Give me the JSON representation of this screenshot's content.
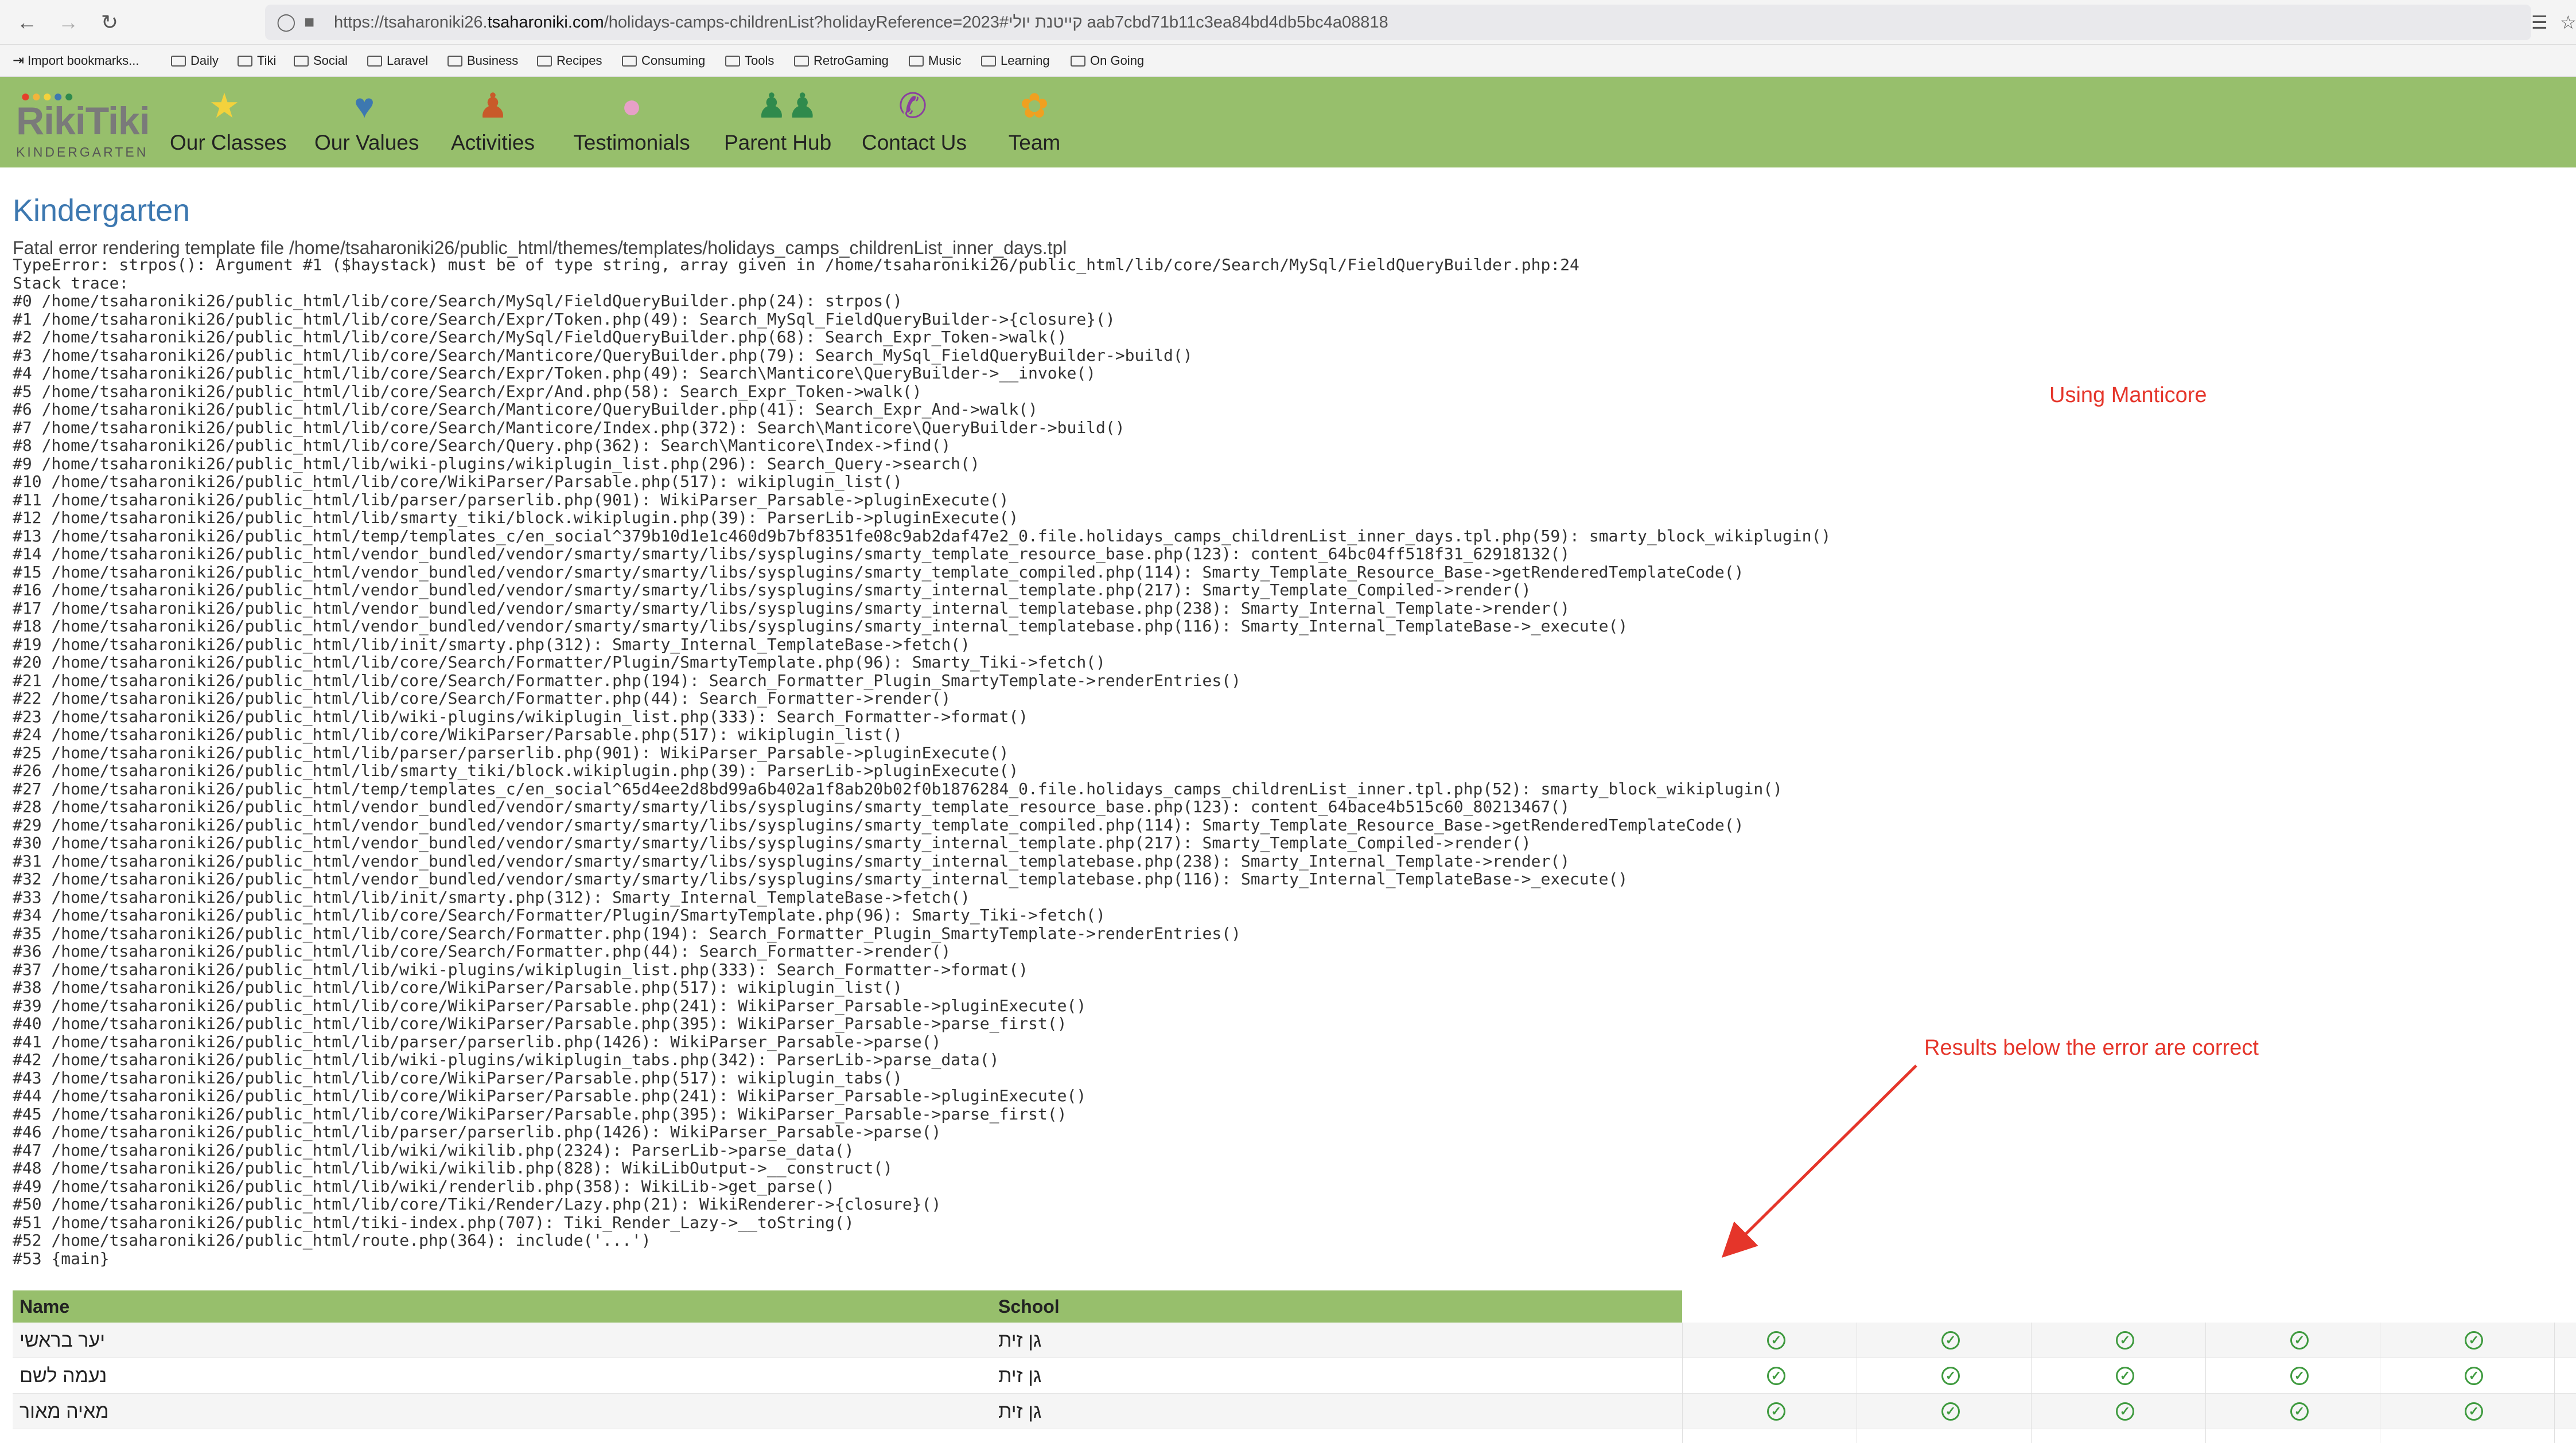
{
  "browser": {
    "url_prefix": "https://tsaharoniki26.",
    "url_domain": "tsaharoniki.com",
    "url_path": "/holidays-camps-childrenList?holidayReference=2023#קייטנת יולי aab7cbd71b11c3ea84bd4db5bc4a08818",
    "bookmarks": [
      "Import bookmarks...",
      "Daily",
      "Tiki",
      "Social",
      "Laravel",
      "Business",
      "Recipes",
      "Consuming",
      "Tools",
      "RetroGaming",
      "Music",
      "Learning",
      "On Going"
    ]
  },
  "site": {
    "logo_text": "RikiTiki",
    "logo_sub": "KINDERGARTEN",
    "nav": [
      {
        "label": "Our Classes",
        "icon": "star-icon",
        "glyph": "★",
        "color": "#f3d23c"
      },
      {
        "label": "Our Values",
        "icon": "hand-heart-icon",
        "glyph": "♥",
        "color": "#3d78b0"
      },
      {
        "label": "Activities",
        "icon": "person-icon",
        "glyph": "♟",
        "color": "#c85a2a"
      },
      {
        "label": "Testimonials",
        "icon": "speech-bubble-icon",
        "glyph": "●",
        "color": "#e7a0c8"
      },
      {
        "label": "Parent Hub",
        "icon": "people-icon",
        "glyph": "♟♟",
        "color": "#2f8a4c"
      },
      {
        "label": "Contact Us",
        "icon": "phone-icon",
        "glyph": "✆",
        "color": "#8a3ea0"
      },
      {
        "label": "Team",
        "icon": "team-icon",
        "glyph": "✿",
        "color": "#f0a020"
      }
    ]
  },
  "page": {
    "title": "Kindergarten",
    "error_file": "Fatal error rendering template file /home/tsaharoniki26/public_html/themes/templates/holidays_camps_childrenList_inner_days.tpl",
    "trace": [
      "TypeError: strpos(): Argument #1 ($haystack) must be of type string, array given in /home/tsaharoniki26/public_html/lib/core/Search/MySql/FieldQueryBuilder.php:24",
      "Stack trace:",
      "#0 /home/tsaharoniki26/public_html/lib/core/Search/MySql/FieldQueryBuilder.php(24): strpos()",
      "#1 /home/tsaharoniki26/public_html/lib/core/Search/Expr/Token.php(49): Search_MySql_FieldQueryBuilder->{closure}()",
      "#2 /home/tsaharoniki26/public_html/lib/core/Search/MySql/FieldQueryBuilder.php(68): Search_Expr_Token->walk()",
      "#3 /home/tsaharoniki26/public_html/lib/core/Search/Manticore/QueryBuilder.php(79): Search_MySql_FieldQueryBuilder->build()",
      "#4 /home/tsaharoniki26/public_html/lib/core/Search/Expr/Token.php(49): Search\\Manticore\\QueryBuilder->__invoke()",
      "#5 /home/tsaharoniki26/public_html/lib/core/Search/Expr/And.php(58): Search_Expr_Token->walk()",
      "#6 /home/tsaharoniki26/public_html/lib/core/Search/Manticore/QueryBuilder.php(41): Search_Expr_And->walk()",
      "#7 /home/tsaharoniki26/public_html/lib/core/Search/Manticore/Index.php(372): Search\\Manticore\\QueryBuilder->build()",
      "#8 /home/tsaharoniki26/public_html/lib/core/Search/Query.php(362): Search\\Manticore\\Index->find()",
      "#9 /home/tsaharoniki26/public_html/lib/wiki-plugins/wikiplugin_list.php(296): Search_Query->search()",
      "#10 /home/tsaharoniki26/public_html/lib/core/WikiParser/Parsable.php(517): wikiplugin_list()",
      "#11 /home/tsaharoniki26/public_html/lib/parser/parserlib.php(901): WikiParser_Parsable->pluginExecute()",
      "#12 /home/tsaharoniki26/public_html/lib/smarty_tiki/block.wikiplugin.php(39): ParserLib->pluginExecute()",
      "#13 /home/tsaharoniki26/public_html/temp/templates_c/en_social^379b10d1e1c460d9b7bf8351fe08c9ab2daf47e2_0.file.holidays_camps_childrenList_inner_days.tpl.php(59): smarty_block_wikiplugin()",
      "#14 /home/tsaharoniki26/public_html/vendor_bundled/vendor/smarty/smarty/libs/sysplugins/smarty_template_resource_base.php(123): content_64bc04ff518f31_62918132()",
      "#15 /home/tsaharoniki26/public_html/vendor_bundled/vendor/smarty/smarty/libs/sysplugins/smarty_template_compiled.php(114): Smarty_Template_Resource_Base->getRenderedTemplateCode()",
      "#16 /home/tsaharoniki26/public_html/vendor_bundled/vendor/smarty/smarty/libs/sysplugins/smarty_internal_template.php(217): Smarty_Template_Compiled->render()",
      "#17 /home/tsaharoniki26/public_html/vendor_bundled/vendor/smarty/smarty/libs/sysplugins/smarty_internal_templatebase.php(238): Smarty_Internal_Template->render()",
      "#18 /home/tsaharoniki26/public_html/vendor_bundled/vendor/smarty/smarty/libs/sysplugins/smarty_internal_templatebase.php(116): Smarty_Internal_TemplateBase->_execute()",
      "#19 /home/tsaharoniki26/public_html/lib/init/smarty.php(312): Smarty_Internal_TemplateBase->fetch()",
      "#20 /home/tsaharoniki26/public_html/lib/core/Search/Formatter/Plugin/SmartyTemplate.php(96): Smarty_Tiki->fetch()",
      "#21 /home/tsaharoniki26/public_html/lib/core/Search/Formatter.php(194): Search_Formatter_Plugin_SmartyTemplate->renderEntries()",
      "#22 /home/tsaharoniki26/public_html/lib/core/Search/Formatter.php(44): Search_Formatter->render()",
      "#23 /home/tsaharoniki26/public_html/lib/wiki-plugins/wikiplugin_list.php(333): Search_Formatter->format()",
      "#24 /home/tsaharoniki26/public_html/lib/core/WikiParser/Parsable.php(517): wikiplugin_list()",
      "#25 /home/tsaharoniki26/public_html/lib/parser/parserlib.php(901): WikiParser_Parsable->pluginExecute()",
      "#26 /home/tsaharoniki26/public_html/lib/smarty_tiki/block.wikiplugin.php(39): ParserLib->pluginExecute()",
      "#27 /home/tsaharoniki26/public_html/temp/templates_c/en_social^65d4ee2d8bd99a6b402a1f8ab20b02f0b1876284_0.file.holidays_camps_childrenList_inner.tpl.php(52): smarty_block_wikiplugin()",
      "#28 /home/tsaharoniki26/public_html/vendor_bundled/vendor/smarty/smarty/libs/sysplugins/smarty_template_resource_base.php(123): content_64bace4b515c60_80213467()",
      "#29 /home/tsaharoniki26/public_html/vendor_bundled/vendor/smarty/smarty/libs/sysplugins/smarty_template_compiled.php(114): Smarty_Template_Resource_Base->getRenderedTemplateCode()",
      "#30 /home/tsaharoniki26/public_html/vendor_bundled/vendor/smarty/smarty/libs/sysplugins/smarty_internal_template.php(217): Smarty_Template_Compiled->render()",
      "#31 /home/tsaharoniki26/public_html/vendor_bundled/vendor/smarty/smarty/libs/sysplugins/smarty_internal_templatebase.php(238): Smarty_Internal_Template->render()",
      "#32 /home/tsaharoniki26/public_html/vendor_bundled/vendor/smarty/smarty/libs/sysplugins/smarty_internal_templatebase.php(116): Smarty_Internal_TemplateBase->_execute()",
      "#33 /home/tsaharoniki26/public_html/lib/init/smarty.php(312): Smarty_Internal_TemplateBase->fetch()",
      "#34 /home/tsaharoniki26/public_html/lib/core/Search/Formatter/Plugin/SmartyTemplate.php(96): Smarty_Tiki->fetch()",
      "#35 /home/tsaharoniki26/public_html/lib/core/Search/Formatter.php(194): Search_Formatter_Plugin_SmartyTemplate->renderEntries()",
      "#36 /home/tsaharoniki26/public_html/lib/core/Search/Formatter.php(44): Search_Formatter->render()",
      "#37 /home/tsaharoniki26/public_html/lib/wiki-plugins/wikiplugin_list.php(333): Search_Formatter->format()",
      "#38 /home/tsaharoniki26/public_html/lib/core/WikiParser/Parsable.php(517): wikiplugin_list()",
      "#39 /home/tsaharoniki26/public_html/lib/core/WikiParser/Parsable.php(241): WikiParser_Parsable->pluginExecute()",
      "#40 /home/tsaharoniki26/public_html/lib/core/WikiParser/Parsable.php(395): WikiParser_Parsable->parse_first()",
      "#41 /home/tsaharoniki26/public_html/lib/parser/parserlib.php(1426): WikiParser_Parsable->parse()",
      "#42 /home/tsaharoniki26/public_html/lib/wiki-plugins/wikiplugin_tabs.php(342): ParserLib->parse_data()",
      "#43 /home/tsaharoniki26/public_html/lib/core/WikiParser/Parsable.php(517): wikiplugin_tabs()",
      "#44 /home/tsaharoniki26/public_html/lib/core/WikiParser/Parsable.php(241): WikiParser_Parsable->pluginExecute()",
      "#45 /home/tsaharoniki26/public_html/lib/core/WikiParser/Parsable.php(395): WikiParser_Parsable->parse_first()",
      "#46 /home/tsaharoniki26/public_html/lib/parser/parserlib.php(1426): WikiParser_Parsable->parse()",
      "#47 /home/tsaharoniki26/public_html/lib/wiki/wikilib.php(2324): ParserLib->parse_data()",
      "#48 /home/tsaharoniki26/public_html/lib/wiki/wikilib.php(828): WikiLibOutput->__construct()",
      "#49 /home/tsaharoniki26/public_html/lib/wiki/renderlib.php(358): WikiLib->get_parse()",
      "#50 /home/tsaharoniki26/public_html/lib/core/Tiki/Render/Lazy.php(21): WikiRenderer->{closure}()",
      "#51 /home/tsaharoniki26/public_html/tiki-index.php(707): Tiki_Render_Lazy->__toString()",
      "#52 /home/tsaharoniki26/public_html/route.php(364): include('...')",
      "#53 {main}"
    ],
    "note_manticore": "Using Manticore",
    "note_results": "Results below the error are correct",
    "note_color": "#e5352a"
  },
  "table": {
    "headers": [
      "Name",
      "School"
    ],
    "rows": [
      {
        "name": "יער בראשי",
        "school": "גן זית",
        "checks": [
          true,
          true,
          true,
          true,
          true
        ]
      },
      {
        "name": "נעמה לשם",
        "school": "גן זית",
        "checks": [
          true,
          true,
          true,
          true,
          true
        ]
      },
      {
        "name": "מאיה מאור",
        "school": "גן זית",
        "checks": [
          true,
          true,
          true,
          true,
          true
        ]
      }
    ]
  }
}
